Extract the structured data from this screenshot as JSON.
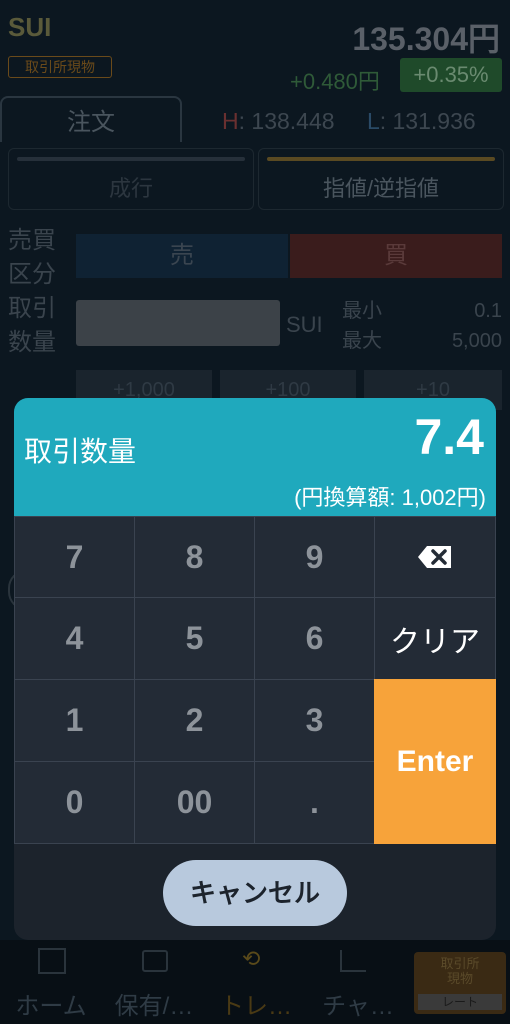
{
  "header": {
    "symbol": "SUI",
    "market_badge": "取引所現物",
    "price": "135.304円",
    "change": "+0.480円",
    "change_pct": "+0.35%",
    "tab_order": "注文",
    "high_label": "H",
    "high_value": ": 138.448",
    "low_label": "L",
    "low_value": ": 131.936"
  },
  "order_types": {
    "market": "成行",
    "limit": "指値/逆指値"
  },
  "form": {
    "side_label_1": "売買",
    "side_label_2": "区分",
    "sell": "売",
    "buy": "買",
    "qty_label_1": "取引",
    "qty_label_2": "数量",
    "unit": "SUI",
    "min_label": "最小",
    "min_value": "0.1",
    "max_label": "最大",
    "max_value": "5,000",
    "quick_1": "+1,000",
    "quick_2": "+100",
    "quick_3": "+10"
  },
  "keypad": {
    "title": "取引数量",
    "value": "7.4",
    "conversion": "(円換算額: 1,002円)",
    "keys": [
      "7",
      "8",
      "9",
      "4",
      "5",
      "6",
      "1",
      "2",
      "3",
      "0",
      "00",
      "."
    ],
    "clear": "クリア",
    "enter": "Enter",
    "cancel": "キャンセル"
  },
  "bottom_nav": {
    "home": "ホーム",
    "holdings": "保有/…",
    "trade": "トレ…",
    "chart": "チャ…",
    "badge_top": "取引所\n現物",
    "badge_bottom": "レート"
  },
  "colors": {
    "accent_teal": "#1fa9bd",
    "enter_orange": "#f7a33a",
    "sell_blue": "#1d3a55",
    "buy_red": "#7a2a2a",
    "positive_green": "#2e8b3e"
  }
}
